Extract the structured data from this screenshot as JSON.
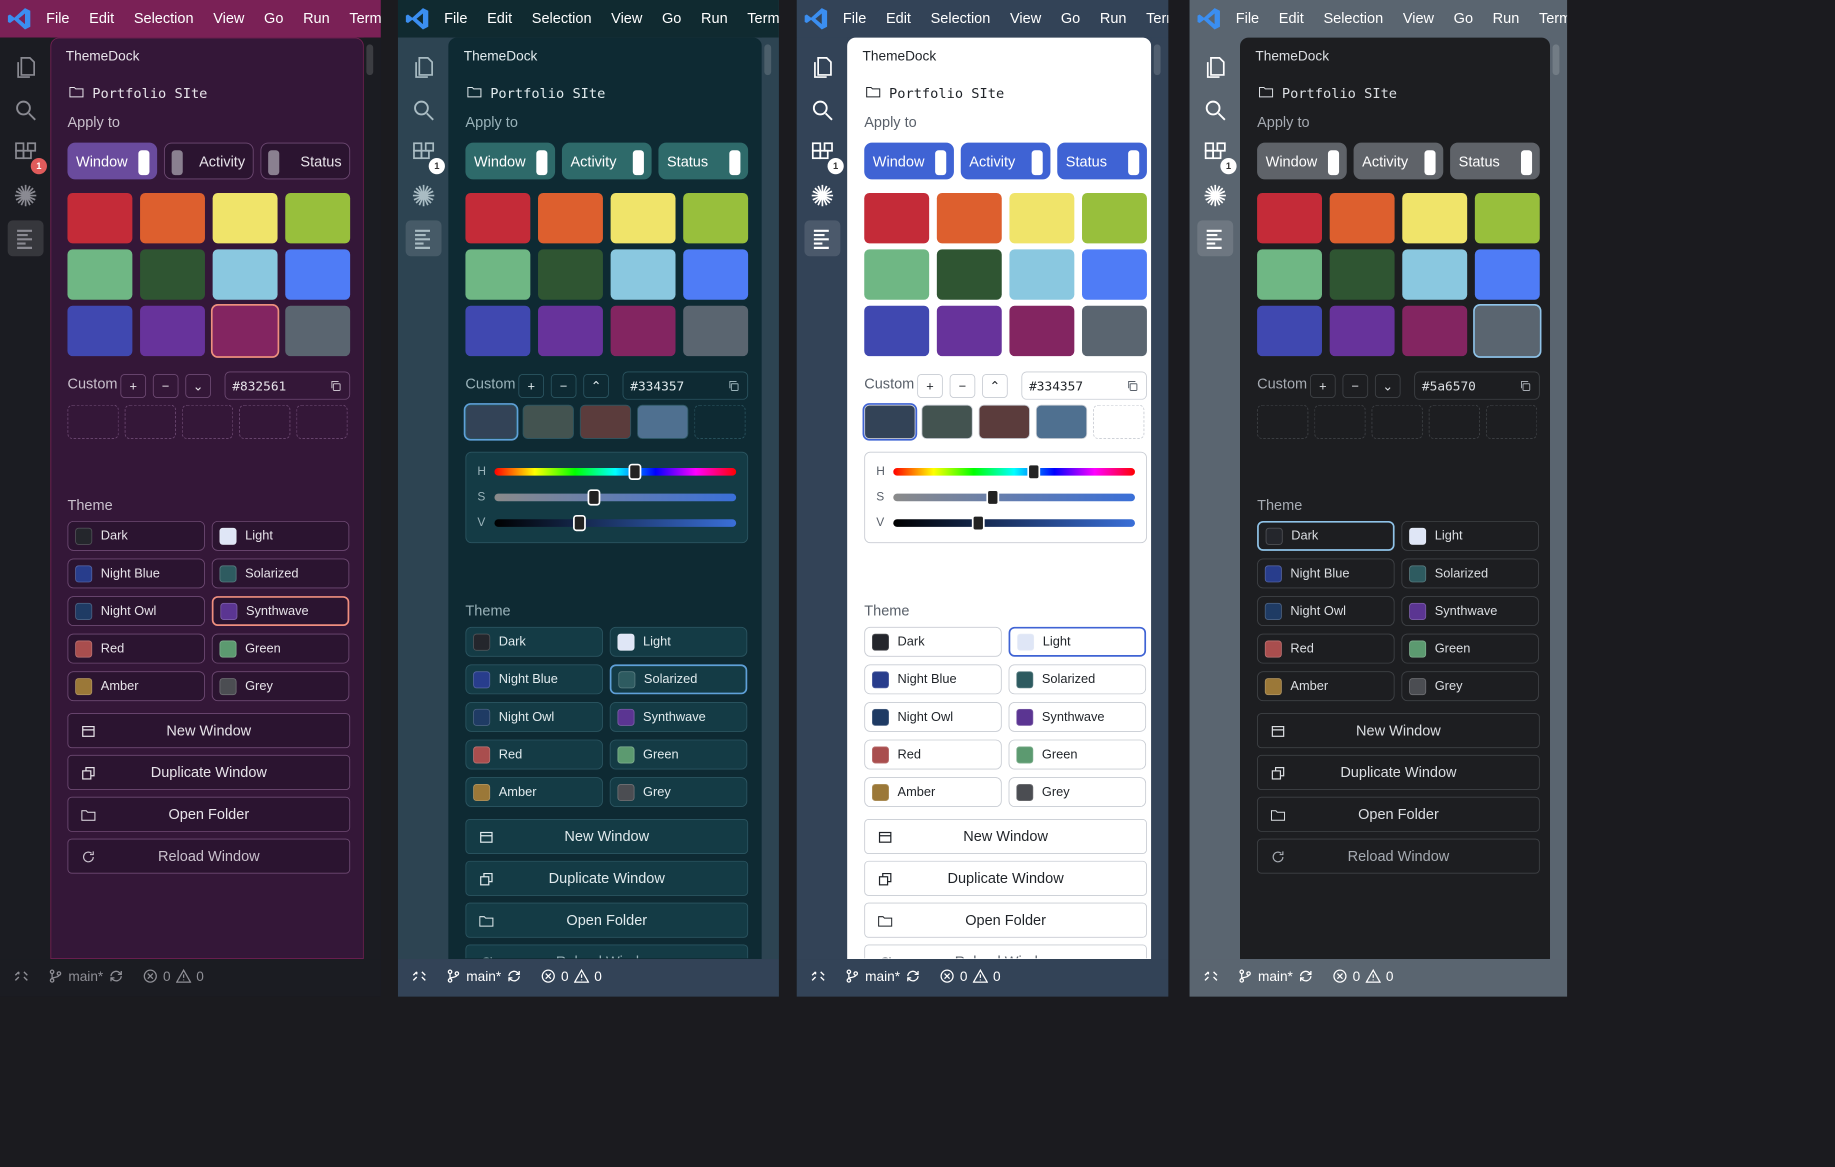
{
  "menu": [
    "File",
    "Edit",
    "Selection",
    "View",
    "Go",
    "Run",
    "Terminal"
  ],
  "sidebar_title": "ThemeDock",
  "project_name": "Portfolio SIte",
  "apply_label": "Apply to",
  "targets": [
    "Window",
    "Activity",
    "Status"
  ],
  "swatches": [
    "#c42b38",
    "#dd5f2e",
    "#f0e46a",
    "#98bf3c",
    "#6fb784",
    "#2f5532",
    "#8ac8e0",
    "#4f7cf6",
    "#4048b0",
    "#67339b",
    "#832561",
    "#5a6570"
  ],
  "custom_label": "Custom",
  "theme_label": "Theme",
  "themes": [
    {
      "name": "Dark",
      "color": "#24262c"
    },
    {
      "name": "Light",
      "color": "#dfe6f6"
    },
    {
      "name": "Night Blue",
      "color": "#283d8c"
    },
    {
      "name": "Solarized",
      "color": "#2e5b60"
    },
    {
      "name": "Night Owl",
      "color": "#1f3b64"
    },
    {
      "name": "Synthwave",
      "color": "#5b3592"
    },
    {
      "name": "Red",
      "color": "#a94e4e"
    },
    {
      "name": "Green",
      "color": "#5c9a70"
    },
    {
      "name": "Amber",
      "color": "#9b7838"
    },
    {
      "name": "Grey",
      "color": "#4b4d52"
    }
  ],
  "hsv_labels": [
    "H",
    "S",
    "V"
  ],
  "actions": [
    "New Window",
    "Duplicate Window",
    "Open Folder",
    "Reload Window"
  ],
  "status": {
    "branch": "main*",
    "errors": "0",
    "warnings": "0"
  },
  "panels": [
    {
      "id": "synthwave",
      "hex": "#832561",
      "sel_swatch": 10,
      "sel_theme": 5,
      "toggles_on": [
        true,
        false,
        false
      ],
      "hsv": false,
      "hsv_values": [],
      "recent": [],
      "caret": "down",
      "colors": {
        "menu": "#7a2156",
        "menutext": "#ffffff",
        "act": "#1b1c22",
        "side": "#341738",
        "sideborder": "#7a2156",
        "text": "#e8e4ea",
        "muted": "#c9c0cc",
        "card": "#2b1430",
        "cardborder": "#6e4a73",
        "togon": "#6a4b9d",
        "togoff": "#2b1430",
        "knob": "#ffffff",
        "knoboff": "#8a8090",
        "accent": "#ef8f7f",
        "status": "#1b1c22",
        "statustext": "#8f8f96",
        "icon": "#8a8a92"
      }
    },
    {
      "id": "solarized",
      "hex": "#334357",
      "sel_swatch": -1,
      "sel_theme": 3,
      "toggles_on": [
        true,
        true,
        true
      ],
      "hsv": true,
      "hsv_values": [
        0.58,
        0.41,
        0.35
      ],
      "recent": [
        "#334357",
        "#435350",
        "#5b3c3c",
        "#4f7090"
      ],
      "caret": "up",
      "colors": {
        "menu": "#102a30",
        "menutext": "#ffffff",
        "act": "#2d4452",
        "side": "#0e2a33",
        "sideborder": "#0e2a33",
        "text": "#e1ebee",
        "muted": "#9ab3ba",
        "card": "#143b45",
        "cardborder": "#2b5561",
        "togon": "#2e6a6a",
        "togoff": "#143b45",
        "knob": "#ffffff",
        "knoboff": "#8fa8ae",
        "accent": "#5fa0d8",
        "status": "#334357",
        "statustext": "#ffffff",
        "icon": "#a9bcc3"
      }
    },
    {
      "id": "light",
      "hex": "#334357",
      "sel_swatch": -1,
      "sel_theme": 1,
      "toggles_on": [
        true,
        true,
        true
      ],
      "hsv": true,
      "hsv_values": [
        0.58,
        0.41,
        0.35
      ],
      "recent": [
        "#334357",
        "#435350",
        "#5b3c3c",
        "#4f7090"
      ],
      "caret": "up",
      "colors": {
        "menu": "#334357",
        "menutext": "#ffffff",
        "act": "#334357",
        "side": "#ffffff",
        "sideborder": "#ffffff",
        "text": "#1f2328",
        "muted": "#59606a",
        "card": "#ffffff",
        "cardborder": "#c8ccd3",
        "togon": "#3f63d4",
        "togoff": "#ffffff",
        "knob": "#ffffff",
        "knoboff": "#aaa",
        "accent": "#3f63d4",
        "status": "#334357",
        "statustext": "#ffffff",
        "icon": "#ffffff"
      }
    },
    {
      "id": "dark",
      "hex": "#5a6570",
      "sel_swatch": 11,
      "sel_theme": 0,
      "toggles_on": [
        true,
        true,
        true
      ],
      "hsv": false,
      "hsv_values": [],
      "recent": [],
      "caret": "down",
      "colors": {
        "menu": "#5a6570",
        "menutext": "#ffffff",
        "act": "#5a6570",
        "side": "#1d1e21",
        "sideborder": "#1d1e21",
        "text": "#dcdfe3",
        "muted": "#a6abb2",
        "card": "#1d1e21",
        "cardborder": "#3f4246",
        "togon": "#5f6369",
        "togoff": "#1d1e21",
        "knob": "#ffffff",
        "knoboff": "#888",
        "accent": "#8fc3e8",
        "status": "#5a6570",
        "statustext": "#ffffff",
        "icon": "#ffffff"
      }
    }
  ]
}
